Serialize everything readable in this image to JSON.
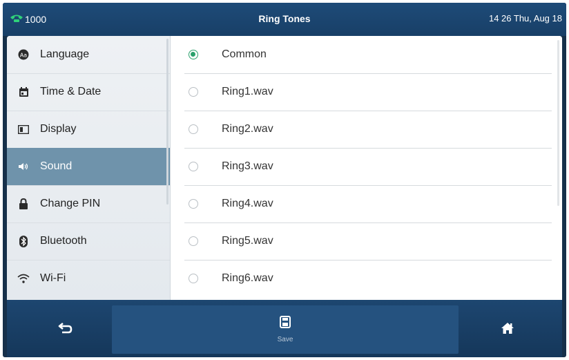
{
  "status": {
    "account": "1000",
    "title": "Ring Tones",
    "datetime": "14 26 Thu, Aug 18"
  },
  "sidebar": {
    "items": [
      {
        "label": "Language",
        "icon": "language-icon"
      },
      {
        "label": "Time & Date",
        "icon": "calendar-icon"
      },
      {
        "label": "Display",
        "icon": "display-icon"
      },
      {
        "label": "Sound",
        "icon": "speaker-icon",
        "active": true
      },
      {
        "label": "Change PIN",
        "icon": "lock-icon"
      },
      {
        "label": "Bluetooth",
        "icon": "bluetooth-icon"
      },
      {
        "label": "Wi-Fi",
        "icon": "wifi-icon"
      }
    ]
  },
  "ringtones": {
    "selected": "Common",
    "options": [
      "Common",
      "Ring1.wav",
      "Ring2.wav",
      "Ring3.wav",
      "Ring4.wav",
      "Ring5.wav",
      "Ring6.wav"
    ]
  },
  "softkeys": {
    "back_icon": "back-icon",
    "save_label": "Save",
    "home_icon": "home-icon"
  },
  "colors": {
    "status_bar": "#1e4b78",
    "sidebar_active": "#6f93ab",
    "radio_selected": "#29a06b",
    "softkey_bar": "#1d4670"
  }
}
